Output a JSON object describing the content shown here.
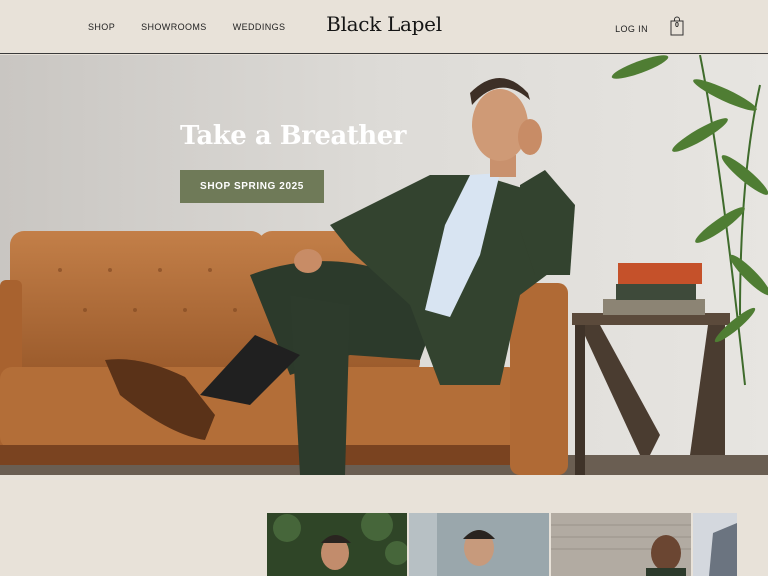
{
  "header": {
    "nav_left": [
      {
        "label": "SHOP"
      },
      {
        "label": "SHOWROOMS"
      },
      {
        "label": "WEDDINGS"
      }
    ],
    "logo": "Black Lapel",
    "login_label": "LOG IN",
    "cart_count": "0"
  },
  "hero": {
    "title": "Take a Breather",
    "cta_label": "SHOP SPRING 2025"
  },
  "colors": {
    "background": "#e8e2d9",
    "cta": "#6f7a58",
    "sofa": "#b8733d",
    "suit": "#2f3d2e"
  },
  "icons": {
    "cart": "shopping-bag-icon"
  }
}
